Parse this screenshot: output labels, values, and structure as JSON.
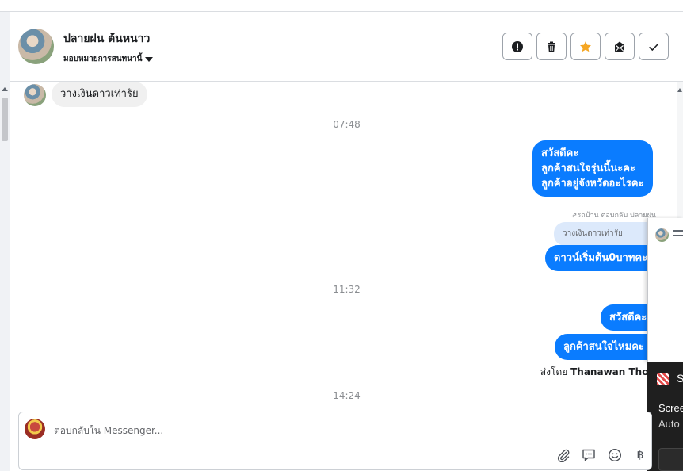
{
  "header": {
    "contact_name": "ปลายฝน ต้นหนาว",
    "assign_label": "มอบหมายการสนทนานี้",
    "actions": [
      {
        "id": "alert",
        "icon": "exclamation-icon"
      },
      {
        "id": "delete",
        "icon": "trash-icon"
      },
      {
        "id": "star",
        "icon": "star-icon",
        "color": "#f5a623"
      },
      {
        "id": "mark-unread",
        "icon": "envelope-icon"
      },
      {
        "id": "done",
        "icon": "checkmark-icon"
      }
    ]
  },
  "messages": {
    "incoming_1": "วางเงินดาวเท่ารัย",
    "time_1": "07:48",
    "outgoing_1": [
      "สวัสดีคะ",
      "ลูกค้าสนใจรุ่นนี้นะคะ",
      "ลูกค้าอยู่จังหวัดอะไรคะ"
    ],
    "reply_note": "⇗รถบ้าน ตอบกลับ ปลายฝน",
    "quoted_text": "วางเงินดาวเท่ารัย",
    "outgoing_2": "ดาวน์เริ่มต้น0บาทคะ",
    "time_2": "11:32",
    "outgoing_3": "สวัสดีคะ",
    "outgoing_4": "ลูกค้าสนใจไหมคะ",
    "sent_by_prefix": "ส่งโดย",
    "sent_by_name": "Thanawan Thon",
    "time_3": "14:24"
  },
  "overlay": {
    "notif_letter": "S",
    "notif_line1": "Scree",
    "notif_line2": "Auto"
  },
  "composer": {
    "placeholder": "ตอบกลับใน Messenger...",
    "value": "",
    "tools": [
      "paperclip-icon",
      "speech-bubble-icon",
      "emoji-icon",
      "baht-icon"
    ],
    "baht_symbol": "฿"
  },
  "colors": {
    "accent": "#0a7cff",
    "incoming_bubble": "#f0f0f0",
    "quoted_bubble": "#dce9fb",
    "star": "#f5a623"
  }
}
